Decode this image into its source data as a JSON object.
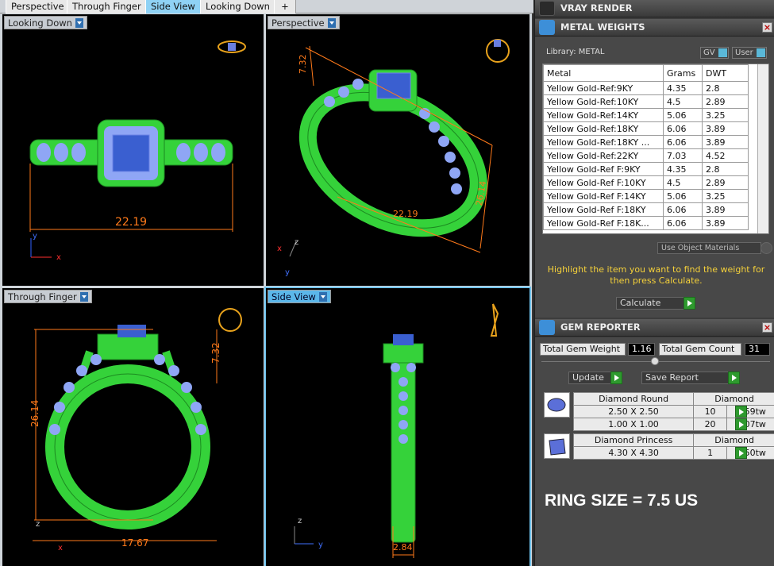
{
  "tabs": [
    {
      "label": "Perspective"
    },
    {
      "label": "Through Finger"
    },
    {
      "label": "Side View",
      "active": true
    },
    {
      "label": "Looking Down"
    },
    {
      "label": "+"
    }
  ],
  "viewports": {
    "top_left": {
      "label": "Looking Down",
      "dimension": "22.19",
      "axis_x": "x",
      "axis_y": "y"
    },
    "top_right": {
      "label": "Perspective",
      "dim_a": "7.32",
      "dim_b": "26.14",
      "dim_c": "22.19",
      "axis_x": "x",
      "axis_y": "y",
      "axis_z": "z"
    },
    "bottom_left": {
      "label": "Through Finger",
      "dim_height": "26.14",
      "dim_top": "7.32",
      "dim_width": "17.67",
      "axis_x": "x",
      "axis_z": "z"
    },
    "bottom_right": {
      "label": "Side View",
      "dim_width": "2.84",
      "axis_y": "y",
      "axis_z": "z"
    }
  },
  "vray": {
    "title": "VRAY RENDER"
  },
  "metal": {
    "title": "METAL WEIGHTS",
    "library": "Library: METAL",
    "toggle_gv": "GV",
    "toggle_user": "User",
    "columns": [
      "Metal",
      "Grams",
      "DWT"
    ],
    "rows": [
      [
        "Yellow Gold-Ref:9KY",
        "4.35",
        "2.8"
      ],
      [
        "Yellow Gold-Ref:10KY",
        "4.5",
        "2.89"
      ],
      [
        "Yellow Gold-Ref:14KY",
        "5.06",
        "3.25"
      ],
      [
        "Yellow Gold-Ref:18KY",
        "6.06",
        "3.89"
      ],
      [
        "Yellow Gold-Ref:18KY ...",
        "6.06",
        "3.89"
      ],
      [
        "Yellow Gold-Ref:22KY",
        "7.03",
        "4.52"
      ],
      [
        "Yellow Gold-Ref F:9KY",
        "4.35",
        "2.8"
      ],
      [
        "Yellow Gold-Ref F:10KY",
        "4.5",
        "2.89"
      ],
      [
        "Yellow Gold-Ref F:14KY",
        "5.06",
        "3.25"
      ],
      [
        "Yellow Gold-Ref F:18KY",
        "6.06",
        "3.89"
      ],
      [
        "Yellow Gold-Ref F:18K...",
        "6.06",
        "3.89"
      ]
    ],
    "use_object_materials": "Use Object Materials",
    "hint": "Highlight the item you want to find the weight for then press Calculate.",
    "calculate": "Calculate"
  },
  "gem": {
    "title": "GEM REPORTER",
    "total_weight_label": "Total Gem Weight",
    "total_weight": "1.16",
    "total_count_label": "Total Gem Count",
    "total_count": "31",
    "update": "Update",
    "save_report": "Save Report",
    "groups": [
      {
        "name": "Diamond Round",
        "material": "Diamond",
        "rows": [
          [
            "2.50 X 2.50",
            "10",
            "0.59tw"
          ],
          [
            "1.00 X 1.00",
            "20",
            "0.07tw"
          ]
        ]
      },
      {
        "name": "Diamond Princess",
        "material": "Diamond",
        "rows": [
          [
            "4.30 X 4.30",
            "1",
            "0.50tw"
          ]
        ]
      }
    ]
  },
  "ring_size": "RING SIZE = 7.5 US",
  "colors": {
    "mesh": "#35d23a",
    "stone": "#8fa6f5",
    "dimension": "#e0782a",
    "active": "#5bb7ea"
  }
}
